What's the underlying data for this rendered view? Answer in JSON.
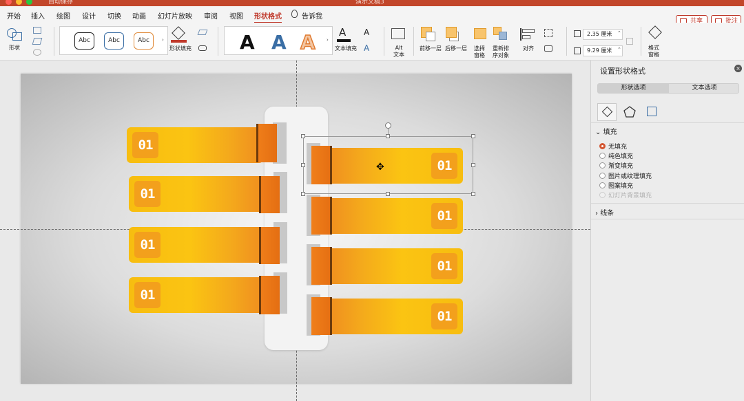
{
  "titlebar": {
    "qat_text": "自动保存",
    "title": "演示文稿3"
  },
  "tabs": [
    {
      "label": "开始"
    },
    {
      "label": "插入"
    },
    {
      "label": "绘图"
    },
    {
      "label": "设计"
    },
    {
      "label": "切换"
    },
    {
      "label": "动画"
    },
    {
      "label": "幻灯片放映"
    },
    {
      "label": "审阅"
    },
    {
      "label": "视图"
    },
    {
      "label": "形状格式"
    },
    {
      "label": "告诉我"
    }
  ],
  "active_tab": "形状格式",
  "top_buttons": {
    "share": "共享",
    "comment": "批注"
  },
  "ribbon": {
    "shape_label": "形状",
    "style_samples": [
      "Abc",
      "Abc",
      "Abc"
    ],
    "shape_fill_label": "形状填充",
    "wordart_letters": [
      "A",
      "A",
      "A"
    ],
    "text_fill_label": "文本填充",
    "alt_text_label": "Alt\n文本",
    "bring_forward": "前移一层",
    "send_backward": "后移一层",
    "selection_pane": "选择\n窗格",
    "reorder_objects": "重新排\n序对象",
    "align": "对齐",
    "height_value": "2.35 厘米",
    "width_value": "9.29 厘米",
    "format_pane": "格式\n窗格",
    "accent_color": "#c0392b"
  },
  "slide": {
    "item_label": "01",
    "left_items": 4,
    "right_items": 4,
    "colors": {
      "yellow": "#fbc412",
      "orange": "#ef8c1f",
      "badge": "#f3a01c"
    }
  },
  "panel": {
    "title": "设置形状格式",
    "segments": [
      "形状选项",
      "文本选项"
    ],
    "active_segment": "形状选项",
    "fill_section": "填充",
    "fill_options": [
      {
        "label": "无填充",
        "selected": true,
        "disabled": false
      },
      {
        "label": "纯色填充",
        "selected": false,
        "disabled": false
      },
      {
        "label": "渐变填充",
        "selected": false,
        "disabled": false
      },
      {
        "label": "图片或纹理填充",
        "selected": false,
        "disabled": false
      },
      {
        "label": "图案填充",
        "selected": false,
        "disabled": false
      },
      {
        "label": "幻灯片背景填充",
        "selected": false,
        "disabled": true
      }
    ],
    "line_section": "线条"
  }
}
